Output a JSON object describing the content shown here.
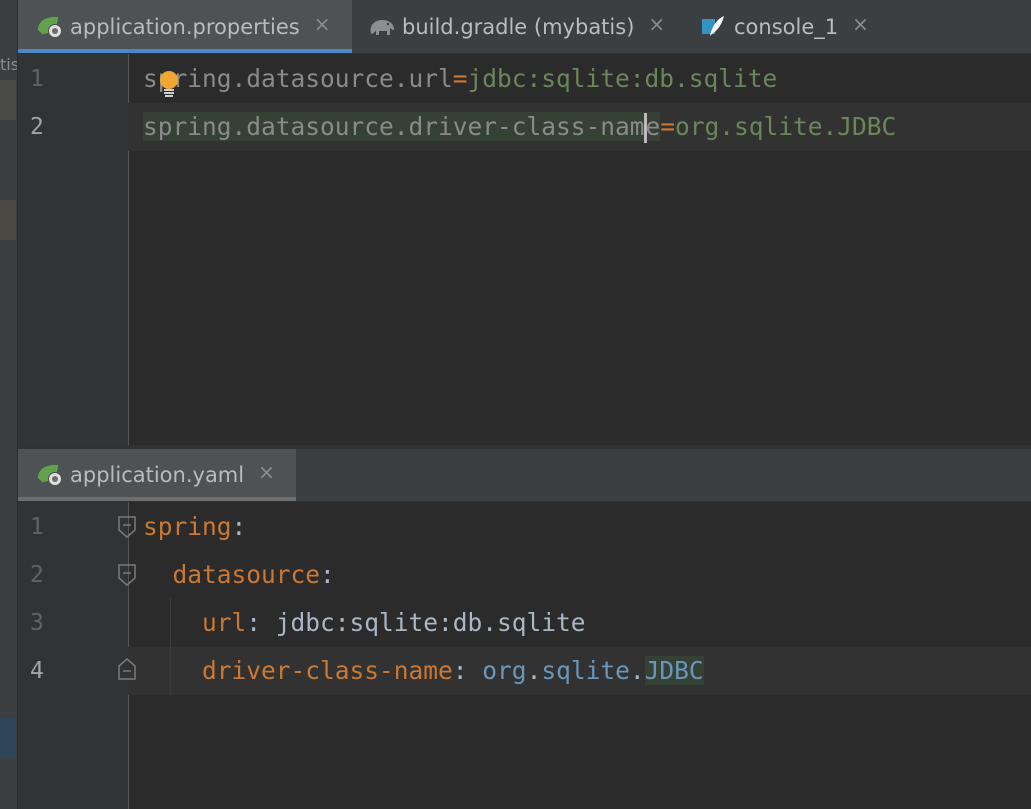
{
  "left_panel": {
    "label": "tis"
  },
  "top_tabs": [
    {
      "label": "application.properties",
      "icon": "spring-leaf-icon",
      "active": true
    },
    {
      "label": "build.gradle (mybatis)",
      "icon": "gradle-elephant-icon",
      "active": false
    },
    {
      "label": "console_1",
      "icon": "console-feather-icon",
      "active": false
    }
  ],
  "close_glyph": "×",
  "properties_editor": {
    "lines": [
      {
        "number": "1",
        "key": "spring.datasource.url",
        "sep": "=",
        "value": "jdbc:sqlite:db.sqlite"
      },
      {
        "number": "2",
        "key_before_caret": "spring.datasource.driver-class-nam",
        "key_after_caret": "e",
        "sep": "=",
        "value": "org.sqlite.JDBC"
      }
    ]
  },
  "bottom_tabs": [
    {
      "label": "application.yaml",
      "icon": "spring-leaf-icon",
      "active": true
    }
  ],
  "yaml_editor": {
    "lines": [
      {
        "number": "1",
        "key": "spring",
        "colon": ":"
      },
      {
        "number": "2",
        "key": "datasource",
        "colon": ":"
      },
      {
        "number": "3",
        "key": "url",
        "colon": ":",
        "value": " jdbc:sqlite:db.sqlite"
      },
      {
        "number": "4",
        "key": "driver-class-name",
        "colon": ":",
        "value_pre": " org",
        "dot1": ".",
        "value_mid": "sqlite",
        "dot2": ".",
        "value_cls": "JDBC"
      }
    ]
  },
  "colors": {
    "editor_bg": "#2b2b2b",
    "tabbar_bg": "#3c3f41",
    "active_tab_underline": "#4a88c7",
    "yaml_key": "#cc7832",
    "string_value": "#6a8759"
  }
}
